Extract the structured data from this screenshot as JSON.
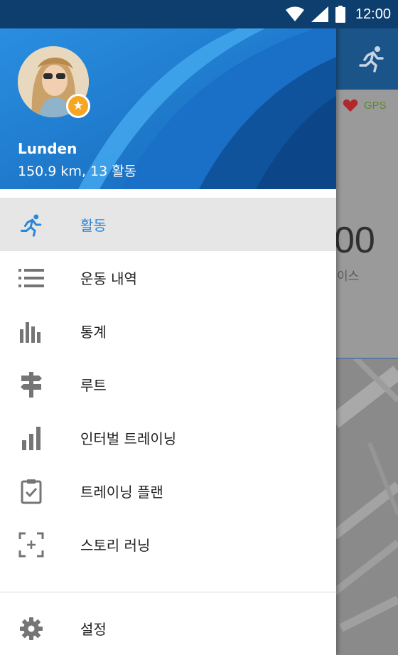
{
  "status_bar": {
    "time": "12:00",
    "icons": [
      "wifi-icon",
      "signal-icon",
      "battery-icon"
    ]
  },
  "drawer": {
    "user": {
      "name": "Lunden",
      "stats": "150.9 km, 13 활동"
    },
    "menu_items": [
      {
        "label": "활동",
        "icon": "runner-icon",
        "active": true
      },
      {
        "label": "운동 내역",
        "icon": "list-icon",
        "active": false
      },
      {
        "label": "통계",
        "icon": "bar-chart-icon",
        "active": false
      },
      {
        "label": "루트",
        "icon": "signpost-icon",
        "active": false
      },
      {
        "label": "인터벌 트레이닝",
        "icon": "interval-bars-icon",
        "active": false
      },
      {
        "label": "트레이닝 플랜",
        "icon": "clipboard-check-icon",
        "active": false
      },
      {
        "label": "스토리 러닝",
        "icon": "story-frame-icon",
        "active": false
      }
    ],
    "settings": {
      "label": "설정",
      "icon": "gear-icon"
    }
  },
  "background_app": {
    "gps_label": "GPS",
    "big_value": "00",
    "sub_label": "이스"
  },
  "colors": {
    "accent": "#2a86d8",
    "header": "#1f7ad0",
    "status_bar": "#0e3e6e",
    "badge": "#f5a623"
  }
}
